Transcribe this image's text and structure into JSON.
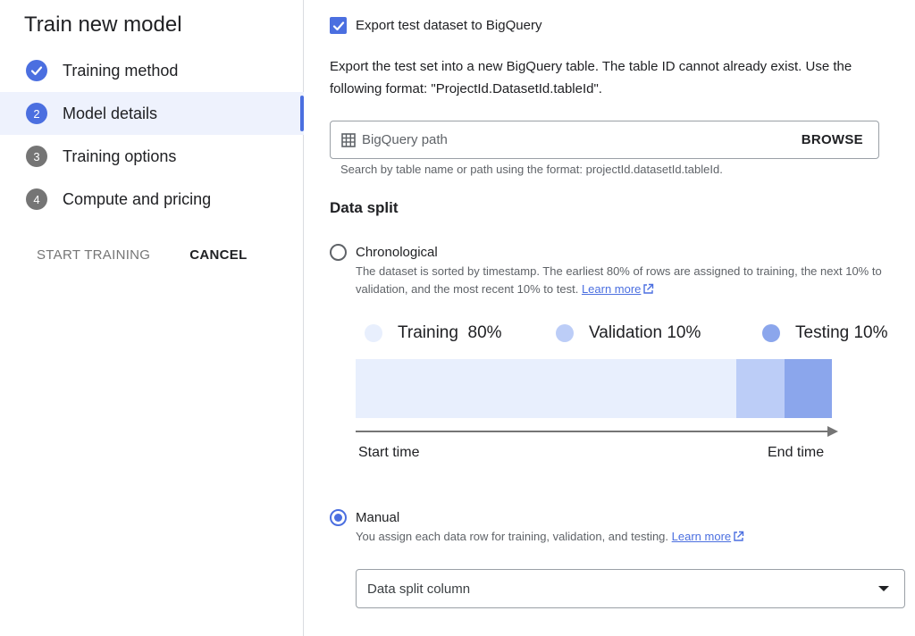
{
  "sidebar": {
    "title": "Train new model",
    "steps": [
      {
        "num": "✓",
        "label": "Training method",
        "state": "done"
      },
      {
        "num": "2",
        "label": "Model details",
        "state": "active"
      },
      {
        "num": "3",
        "label": "Training options",
        "state": "todo"
      },
      {
        "num": "4",
        "label": "Compute and pricing",
        "state": "todo"
      }
    ],
    "start_training": "START TRAINING",
    "cancel": "CANCEL"
  },
  "export": {
    "checkbox_label": "Export test dataset to BigQuery",
    "checked": true,
    "description": "Export the test set into a new BigQuery table. The table ID cannot already exist. Use the following format: \"ProjectId.DatasetId.tableId\".",
    "input_placeholder": "BigQuery path",
    "browse": "BROWSE",
    "hint": "Search by table name or path using the format: projectId.datasetId.tableId."
  },
  "data_split": {
    "title": "Data split",
    "chronological": {
      "label": "Chronological",
      "desc_text": "The dataset is sorted by timestamp. The earliest 80% of rows are assigned to training, the next 10% to validation, and the most recent 10% to test.",
      "learn_more": "Learn more"
    },
    "manual": {
      "label": "Manual",
      "desc_text": "You assign each data row for training, validation, and testing.",
      "learn_more": "Learn more",
      "selected": true
    },
    "select_value": "Data split column"
  },
  "colors": {
    "accent": "#4b6fe0",
    "training": "#e8effd",
    "validation": "#bccdf7",
    "testing": "#8ba6ec"
  },
  "chart_data": {
    "type": "bar",
    "categories": [
      "Training",
      "Validation",
      "Testing"
    ],
    "values": [
      80,
      10,
      10
    ],
    "legend_labels": [
      "Training  80%",
      "Validation 10%",
      "Testing 10%"
    ],
    "xlabel_start": "Start time",
    "xlabel_end": "End time"
  }
}
